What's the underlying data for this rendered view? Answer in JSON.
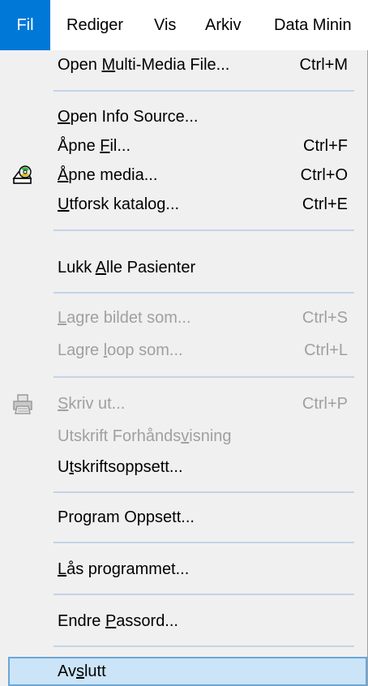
{
  "menubar": {
    "items": [
      "Fil",
      "Rediger",
      "Vis",
      "Arkiv",
      "Data Minin"
    ]
  },
  "menu": {
    "items": [
      {
        "pre": "Open ",
        "u": "M",
        "post": "ulti-Media File...",
        "shortcut": "Ctrl+M"
      },
      {
        "pre": "",
        "u": "O",
        "post": "pen Info Source...",
        "shortcut": ""
      },
      {
        "pre": "Åpne ",
        "u": "F",
        "post": "il...",
        "shortcut": "Ctrl+F"
      },
      {
        "pre": "",
        "u": "Å",
        "post": "pne media...",
        "shortcut": "Ctrl+O",
        "icon": "media-cd-icon"
      },
      {
        "pre": "",
        "u": "U",
        "post": "tforsk katalog...",
        "shortcut": "Ctrl+E"
      },
      {
        "pre": "Lukk ",
        "u": "A",
        "post": "lle Pasienter",
        "shortcut": ""
      },
      {
        "pre": "",
        "u": "L",
        "post": "agre bildet som...",
        "shortcut": "Ctrl+S",
        "disabled": true
      },
      {
        "pre": "Lagre ",
        "u": "l",
        "post": "oop som...",
        "shortcut": "Ctrl+L",
        "disabled": true
      },
      {
        "pre": "",
        "u": "S",
        "post": "kriv ut...",
        "shortcut": "Ctrl+P",
        "disabled": true,
        "icon": "printer-icon"
      },
      {
        "pre": "Utskrift Forhånds",
        "u": "v",
        "post": "isning",
        "shortcut": "",
        "disabled": true
      },
      {
        "pre": "U",
        "u": "t",
        "post": "skriftsoppsett...",
        "shortcut": ""
      },
      {
        "pre": "Program Oppsett...",
        "u": "",
        "post": "",
        "shortcut": ""
      },
      {
        "pre": "",
        "u": "L",
        "post": "ås programmet...",
        "shortcut": ""
      },
      {
        "pre": "Endre ",
        "u": "P",
        "post": "assord...",
        "shortcut": ""
      },
      {
        "pre": "Av",
        "u": "s",
        "post": "lutt",
        "shortcut": "",
        "hover": true
      }
    ]
  },
  "colors": {
    "accent": "#0078d7",
    "hover_bg": "#cce4f7",
    "hover_border": "#6aa7d8",
    "disabled_text": "#a0a0a0",
    "separator": "#c2d4e6"
  }
}
